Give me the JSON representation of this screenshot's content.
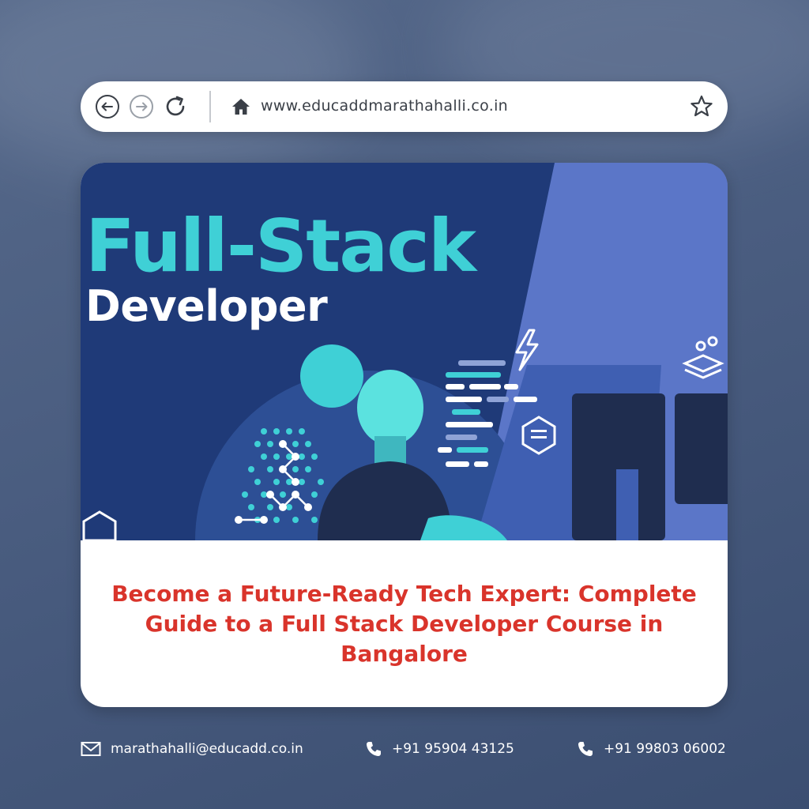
{
  "browser": {
    "url": "www.educaddmarathahalli.co.in",
    "icons": [
      "back-arrow-icon",
      "forward-arrow-icon",
      "reload-icon",
      "home-icon",
      "star-icon"
    ]
  },
  "hero": {
    "title": "Full-Stack",
    "subtitle": "Developer"
  },
  "caption": {
    "text": "Become a Future-Ready Tech Expert: Complete Guide to a Full Stack Developer Course in Bangalore"
  },
  "contacts": {
    "email": "marathahalli@educadd.co.in",
    "phone1": "+91 95904 43125",
    "phone2": "+91 99803 06002"
  },
  "colors": {
    "hero_background": "#1f3a78",
    "title_accent": "#3fd0d6",
    "caption_red": "#d9342b",
    "page_background": "#4a5d80"
  }
}
